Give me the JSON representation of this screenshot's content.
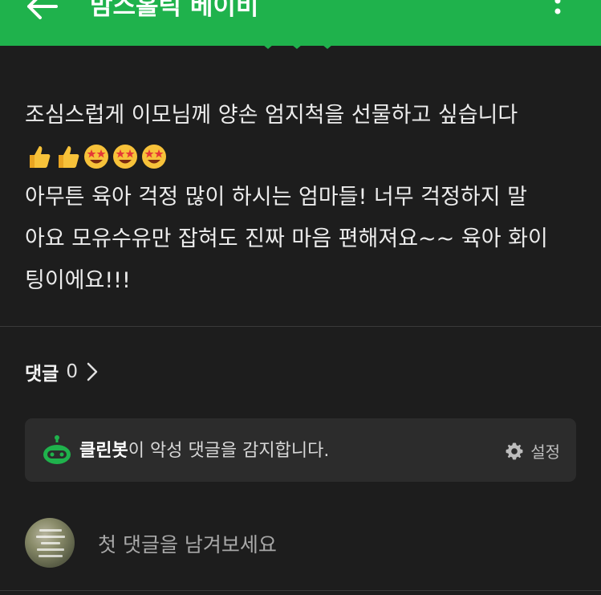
{
  "header": {
    "title": "맘스홀릭 베이비",
    "back_icon": "arrow-left-icon",
    "more_icon": "more-vertical-icon",
    "color": "#1fb24c"
  },
  "post": {
    "lines": [
      "조심스럽게 이모님께 양손 엄지척을 선물하고 싶습니다",
      "아무튼 육아 걱정 많이 하시는 엄마들! 너무 걱정하지 말",
      "아요 모유수유만 잡혀도 진짜 마음 편해져요~~ 육아 화이",
      "팅이에요!!!"
    ],
    "emojis": [
      "thumbs-up",
      "thumbs-up",
      "star-struck",
      "star-struck",
      "star-struck"
    ]
  },
  "comments": {
    "label": "댓글",
    "count": "0"
  },
  "cleanbot": {
    "name": "클린봇",
    "message": "이 악성 댓글을 감지합니다.",
    "settings_label": "설정",
    "icon": "robot-icon"
  },
  "comment_box": {
    "placeholder": "첫 댓글을 남겨보세요"
  }
}
